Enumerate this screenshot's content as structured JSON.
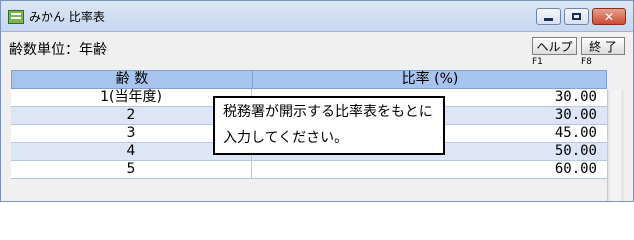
{
  "window": {
    "title": "みかん 比率表",
    "controls": {
      "minimize": "minimize",
      "maximize": "maximize",
      "close": "close"
    }
  },
  "header": {
    "label": "齢数単位：年齢"
  },
  "toolbar": {
    "help_label": "ヘルプ",
    "help_key": "F1",
    "exit_label": "終 了",
    "exit_key": "F8"
  },
  "table": {
    "columns": [
      "齢 数",
      "比率 (%)"
    ],
    "rows": [
      {
        "age": "1(当年度)",
        "ratio": "30.00"
      },
      {
        "age": "2",
        "ratio": "30.00"
      },
      {
        "age": "3",
        "ratio": "45.00"
      },
      {
        "age": "4",
        "ratio": "50.00"
      },
      {
        "age": "5",
        "ratio": "60.00"
      }
    ]
  },
  "tooltip": {
    "text": "税務署が開示する比率表をもとに入力してください。"
  },
  "icons": {
    "app": "spreadsheet-app-icon",
    "minimize": "minimize-icon",
    "maximize": "maximize-icon",
    "close": "close-icon"
  },
  "colors": {
    "header_bg": "#a7c4ee",
    "row_alt_bg": "#dce6f7"
  }
}
